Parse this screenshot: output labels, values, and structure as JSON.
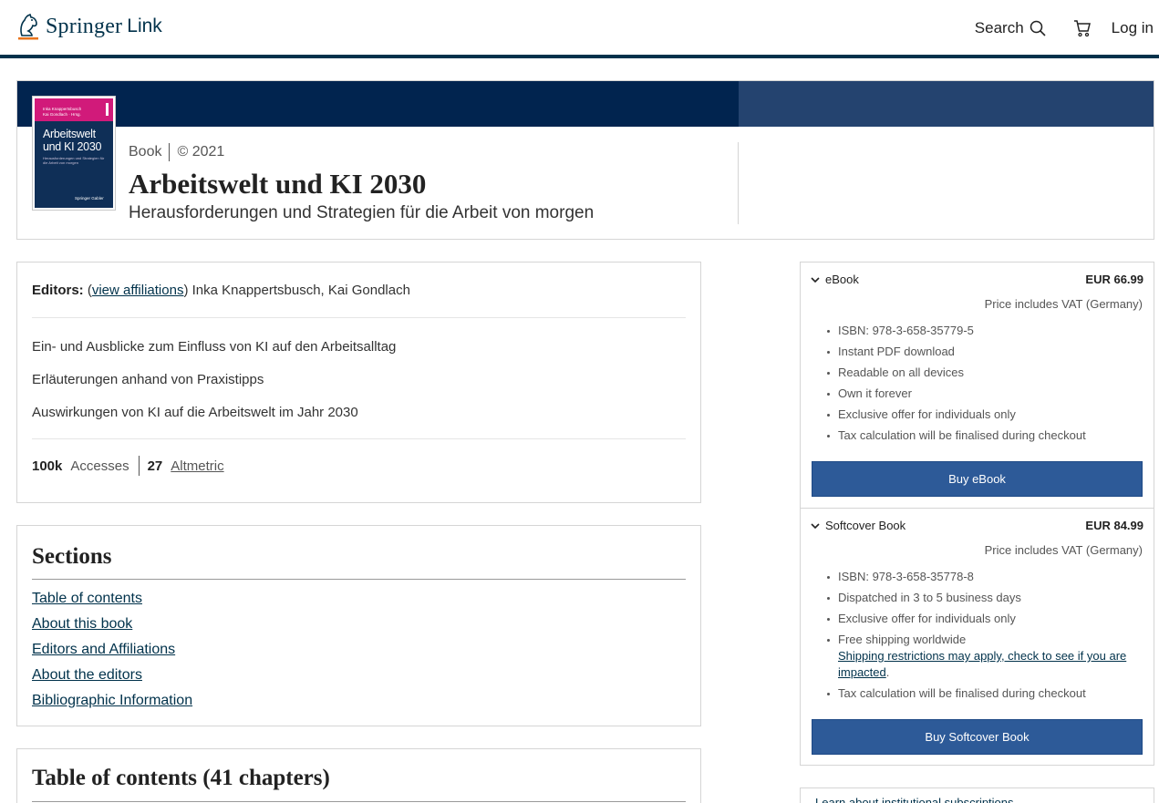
{
  "header": {
    "logo_springer": "Springer",
    "logo_link": "Link",
    "search_label": "Search",
    "login_label": "Log in"
  },
  "colors": {
    "brand_navy": "#01324b",
    "hero_band": "#01244f",
    "hero_band_right": "#24436f",
    "buy_button": "#2d5a98",
    "cover_magenta": "#d11a7a"
  },
  "book": {
    "cover": {
      "authors_line1": "Inka Knappertsbusch",
      "authors_line2": "Kai Gondlach · Hrsg.",
      "title_line1": "Arbeitswelt",
      "title_line2": "und KI 2030",
      "subtitle": "Herausforderungen und Strategien für die Arbeit von morgen",
      "publisher": "Springer Gabler"
    },
    "type": "Book",
    "copyright": "© 2021",
    "title": "Arbeitswelt und KI 2030",
    "subtitle": "Herausforderungen und Strategien für die Arbeit von morgen"
  },
  "info": {
    "editors_label": "Editors:",
    "view_affiliations": "view affiliations",
    "editors_names": "Inka Knappertsbusch, Kai Gondlach",
    "highlights": [
      "Ein- und Ausblicke zum Einfluss von KI auf den Arbeitsalltag",
      "Erläuterungen anhand von Praxistipps",
      "Auswirkungen von KI auf die Arbeitswelt im Jahr 2030"
    ],
    "accesses_value": "100k",
    "accesses_label": "Accesses",
    "altmetric_value": "27",
    "altmetric_label": "Altmetric"
  },
  "sections": {
    "title": "Sections",
    "links": [
      "Table of contents",
      "About this book",
      "Editors and Affiliations",
      "About the editors",
      "Bibliographic Information"
    ]
  },
  "toc": {
    "title": "Table of contents (41 chapters)"
  },
  "buybox": {
    "ebook": {
      "name": "eBook",
      "price": "EUR 66.99",
      "vat": "Price includes VAT (Germany)",
      "features": [
        "ISBN: 978-3-658-35779-5",
        "Instant PDF download",
        "Readable on all devices",
        "Own it forever",
        "Exclusive offer for individuals only",
        "Tax calculation will be finalised during checkout"
      ],
      "button": "Buy eBook"
    },
    "softcover": {
      "name": "Softcover Book",
      "price": "EUR 84.99",
      "vat": "Price includes VAT (Germany)",
      "features": [
        "ISBN: 978-3-658-35778-8",
        "Dispatched in 3 to 5 business days",
        "Exclusive offer for individuals only"
      ],
      "shipping_text": "Free shipping worldwide",
      "shipping_link": "Shipping restrictions may apply, check to see if you are impacted",
      "tax_note": "Tax calculation will be finalised during checkout",
      "button": "Buy Softcover Book"
    },
    "institutional_link": "Learn about institutional subscriptions"
  }
}
